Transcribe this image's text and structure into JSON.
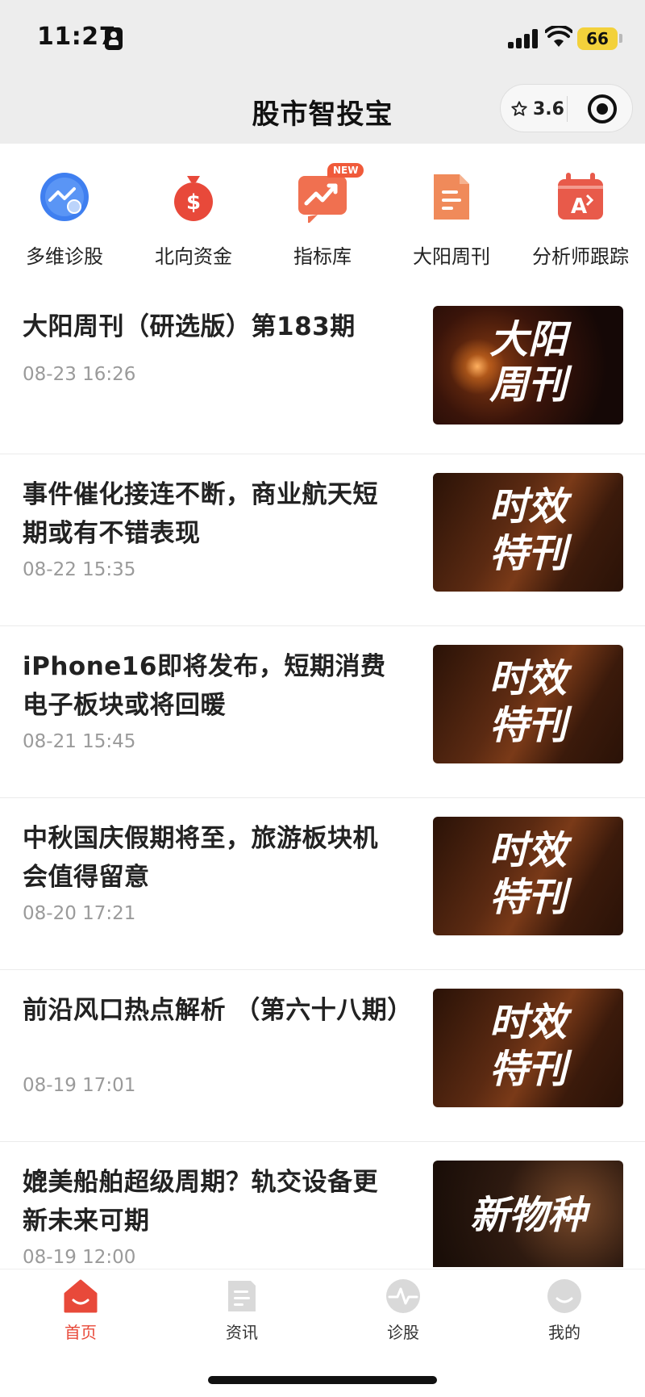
{
  "status_bar": {
    "time": "11:27",
    "battery": "66"
  },
  "header": {
    "title": "股市智投宝",
    "rating": "3.6"
  },
  "quick_nav": [
    {
      "label": "多维诊股",
      "icon": "chart-search-icon",
      "color": "#3f7ff0"
    },
    {
      "label": "北向资金",
      "icon": "money-bag-icon",
      "color": "#e8493a"
    },
    {
      "label": "指标库",
      "icon": "trend-chat-icon",
      "color": "#f07050",
      "badge": "NEW"
    },
    {
      "label": "大阳周刊",
      "icon": "document-icon",
      "color": "#f08a5a"
    },
    {
      "label": "分析师跟踪",
      "icon": "calendar-analyst-icon",
      "color": "#e85a4a"
    }
  ],
  "news": [
    {
      "title": "大阳周刊（研选版）第183期",
      "date": "08-23 16:26",
      "thumb": "大阳周刊",
      "thumb_line1": "大阳",
      "thumb_line2": "周刊"
    },
    {
      "title": "事件催化接连不断，商业航天短期或有不错表现",
      "date": "08-22 15:35",
      "thumb": "时效特刊",
      "thumb_line1": "时效",
      "thumb_line2": "特刊"
    },
    {
      "title": "iPhone16即将发布，短期消费电子板块或将回暖",
      "date": "08-21 15:45",
      "thumb": "时效特刊",
      "thumb_line1": "时效",
      "thumb_line2": "特刊"
    },
    {
      "title": "中秋国庆假期将至，旅游板块机会值得留意",
      "date": "08-20 17:21",
      "thumb": "时效特刊",
      "thumb_line1": "时效",
      "thumb_line2": "特刊"
    },
    {
      "title": "前沿风口热点解析 （第六十八期）",
      "date": "08-19 17:01",
      "thumb": "时效特刊",
      "thumb_line1": "时效",
      "thumb_line2": "特刊"
    },
    {
      "title": "媲美船舶超级周期？轨交设备更新未来可期",
      "date": "08-19 12:00",
      "thumb": "新物种",
      "thumb_line1": "新物种",
      "thumb_line2": ""
    }
  ],
  "tabbar": [
    {
      "label": "首页",
      "icon": "home-icon",
      "active": true
    },
    {
      "label": "资讯",
      "icon": "news-icon",
      "active": false
    },
    {
      "label": "诊股",
      "icon": "pulse-icon",
      "active": false
    },
    {
      "label": "我的",
      "icon": "profile-icon",
      "active": false
    }
  ],
  "colors": {
    "accent": "#e8493a",
    "header_bg": "#ededed",
    "date_text": "#9a9a9a"
  }
}
